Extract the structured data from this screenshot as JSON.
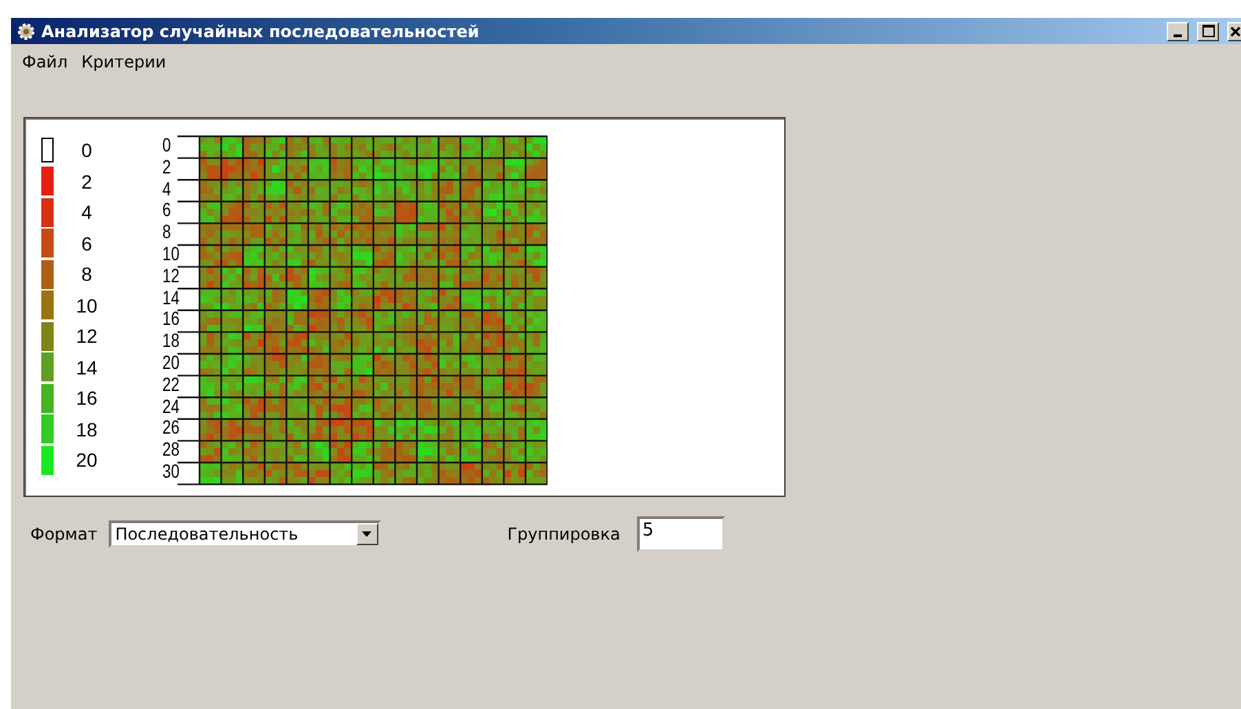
{
  "window": {
    "title": "Анализатор случайных последовательностей"
  },
  "menu": [
    {
      "label": "Файл"
    },
    {
      "label": "Критерии"
    }
  ],
  "legend": [
    {
      "label": "0",
      "color": "#ffffff"
    },
    {
      "label": "2",
      "color": "#e82010"
    },
    {
      "label": "4",
      "color": "#d83010"
    },
    {
      "label": "6",
      "color": "#c84a14"
    },
    {
      "label": "8",
      "color": "#b06014"
    },
    {
      "label": "10",
      "color": "#987414"
    },
    {
      "label": "12",
      "color": "#808418"
    },
    {
      "label": "14",
      "color": "#60a020"
    },
    {
      "label": "16",
      "color": "#44b424"
    },
    {
      "label": "18",
      "color": "#30cc24"
    },
    {
      "label": "20",
      "color": "#18e820"
    }
  ],
  "heatmap": {
    "row_labels": [
      "0",
      "2",
      "4",
      "6",
      "8",
      "10",
      "12",
      "14",
      "16",
      "18",
      "20",
      "22",
      "24",
      "26",
      "28",
      "30"
    ]
  },
  "format": {
    "label": "Формат",
    "value": "Последовательность"
  },
  "grouping": {
    "label": "Группировка",
    "value": "5"
  }
}
